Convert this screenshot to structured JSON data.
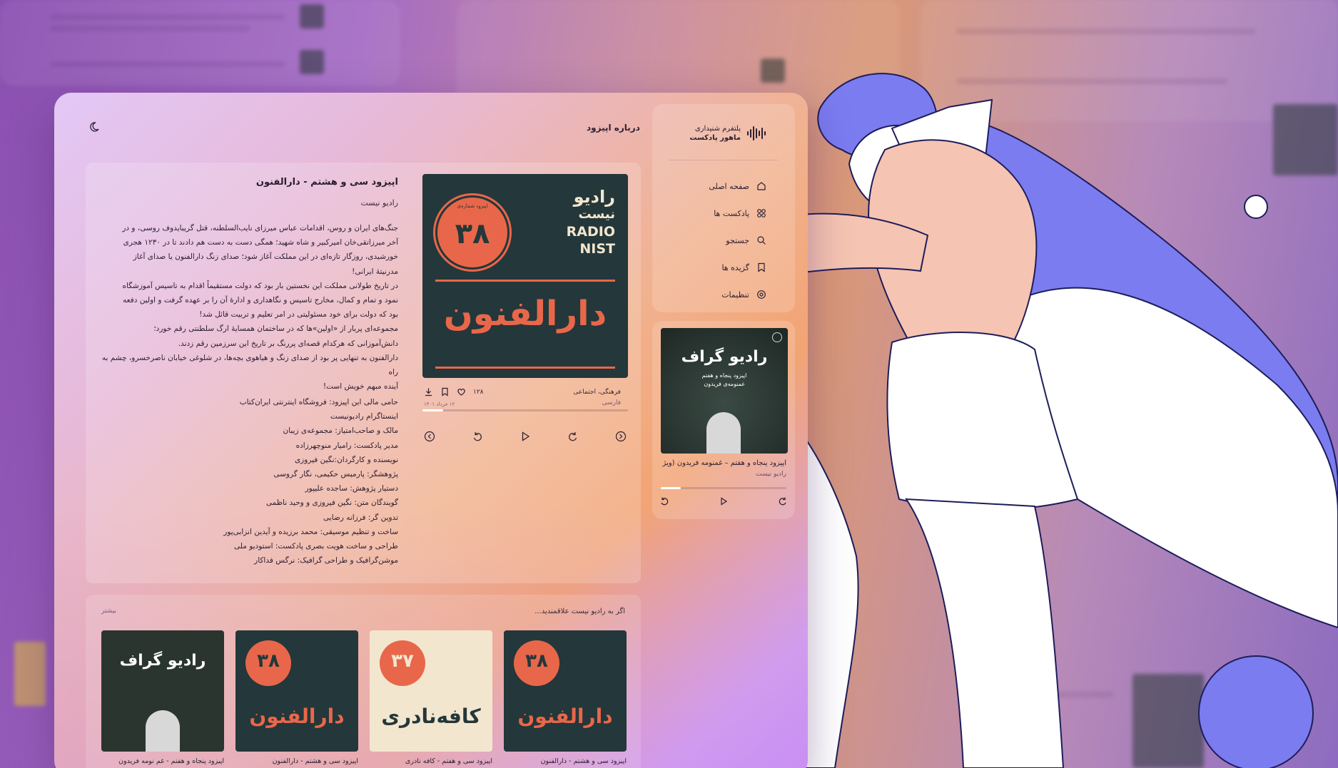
{
  "header": {
    "title": "درباره اپیزود"
  },
  "brand": {
    "line1": "پلتفرم شنیداری",
    "line2": "ماهور پادکست"
  },
  "nav": [
    {
      "label": "صفحه اصلی",
      "icon": "home-icon"
    },
    {
      "label": "پادکست ها",
      "icon": "grid-icon"
    },
    {
      "label": "جستجو",
      "icon": "search-icon"
    },
    {
      "label": "گزیده ها",
      "icon": "bookmark-icon"
    },
    {
      "label": "تنظیمات",
      "icon": "settings-icon"
    }
  ],
  "player": {
    "title": "اپیزود پنجاه و هفتم – غمنومه فریدون (ویژ",
    "subtitle": "رادیو نیست",
    "progress": 0.16,
    "cover_title": "رادیو گراف",
    "cover_sub": "اپیزود پنجاه و هفتم",
    "cover_sub2": "غمنومه‌ی فریدون"
  },
  "episode": {
    "title": "اپیزود سی و هشتم - دارالفنون",
    "podcast": "رادیو نیست",
    "category": "فرهنگی، اجتماعی",
    "language": "فارسی",
    "date": "۱۲ خرداد ۱۴۰۱",
    "likes": "۱۲۸",
    "progress": 0.1,
    "cover_number": "۳۸",
    "cover_name": "دارالفنون",
    "cover_brand1": "رادیو",
    "cover_brand2": "نیست",
    "cover_brand3": "RADIO",
    "cover_brand4": "NIST",
    "cover_ring": "اپیزود شماره‌ی",
    "description": [
      "جنگ‌های ایران و روس، اقدامات عباس میرزای نایب‌السلطنه، قتل گریبایدوف روسی، و در",
      "آخر میرزاتقی‌خان امیرکبیر و شاه شهید؛ همگی دست به دست هم دادند تا در ۱۲۳۰ هجری",
      "خورشیدی، روزگار تازه‌ای در این مملکت آغاز شود؛ صدای زنگ دارالفنون یا صدای آغاز",
      "مدرنیتهٔ ایرانی!",
      "در تاریخ طولانی مملکت این نخستین بار بود که دولت مستقیماً اقدام به تاسیس آموزشگاه",
      "نمود و تمام و کمال، مخارج تاسیس و نگاهداری و ادارهٔ آن را بر عهده گرفت و اولین دفعه",
      "بود که دولت برای خود مسئولیتی در امر تعلیم و تربیت قائل شد!",
      "مجموعه‌ای پربار از «اولین»‌ها که در ساختمان همسایهٔ ارگ سلطنتی رقم خورد؛",
      "دانش‌آموزانی که هرکدام قصه‌ای پررنگ بر تاریخ این سرزمین رقم زدند.",
      "دارالفنون به تنهایی پر بود از صدای زنگ و هیاهوی بچه‌ها، در شلوغی خیابان ناصرخسرو، چشم به راه",
      "آینده مبهم خویش است!"
    ],
    "credits": [
      "حامی مالی این اپیزود: فروشگاه اینترنتی ایران‌کتاب",
      "اینستاگرام رادیونیست",
      "مالک و صاحب‌امتیاز: مجموعه‌ی زیبان",
      "مدیر  پادکست: رامیار منوچهرزاده",
      "نویسنده و کارگردان:نگین فیروزی",
      "پژوهشگر: پارمیس حکیمی، نگار گروسی",
      "دستیار پژوهش: ساجده علیپور",
      "گویندگان متن: نگین فیروزی و وحید ناظمی",
      "تدوین گر: فرزانه رضایی",
      "ساخت و تنظیم موسیقی: محمد برزیده و آیدین انزابی‌پور",
      "طراحی و ساخت هویت بصری پادکست: استودیو ملی",
      "موشن‌گرافیک و طراحی گرافیک: نرگس فداکار"
    ]
  },
  "recommendations": {
    "heading": "اگر به رادیو نیست علاقمندید...",
    "more": "بیشتر",
    "items": [
      {
        "caption": "اپیزود سی و هشتم - دارالفنون",
        "number": "۳۸",
        "name": "دارالفنون",
        "bg": "#24373a",
        "fg": "#e8674a",
        "ring": "#e8674a"
      },
      {
        "caption": "اپیزود سی و هفتم - کافه نادری",
        "number": "۳۷",
        "name": "کافه‌نادری",
        "bg": "#f3e6cf",
        "fg": "#24373a",
        "ring": "#e8674a"
      },
      {
        "caption": "اپیزود سی و هشتم - دارالفنون",
        "number": "۳۸",
        "name": "دارالفنون",
        "bg": "#24373a",
        "fg": "#e8674a",
        "ring": "#e8674a"
      },
      {
        "caption": "اپیزود پنجاه و هفتم - غم نومه فریدون",
        "number": "",
        "name": "رادیو گراف",
        "bg": "#2b3530",
        "fg": "#ffffff",
        "ring": ""
      }
    ]
  },
  "colors": {
    "accent": "#e8674a",
    "dark_teal": "#24373a",
    "cream": "#f3e6cf",
    "illustration_blue": "#7b7cf0",
    "illustration_skin": "#f6c4b2"
  }
}
